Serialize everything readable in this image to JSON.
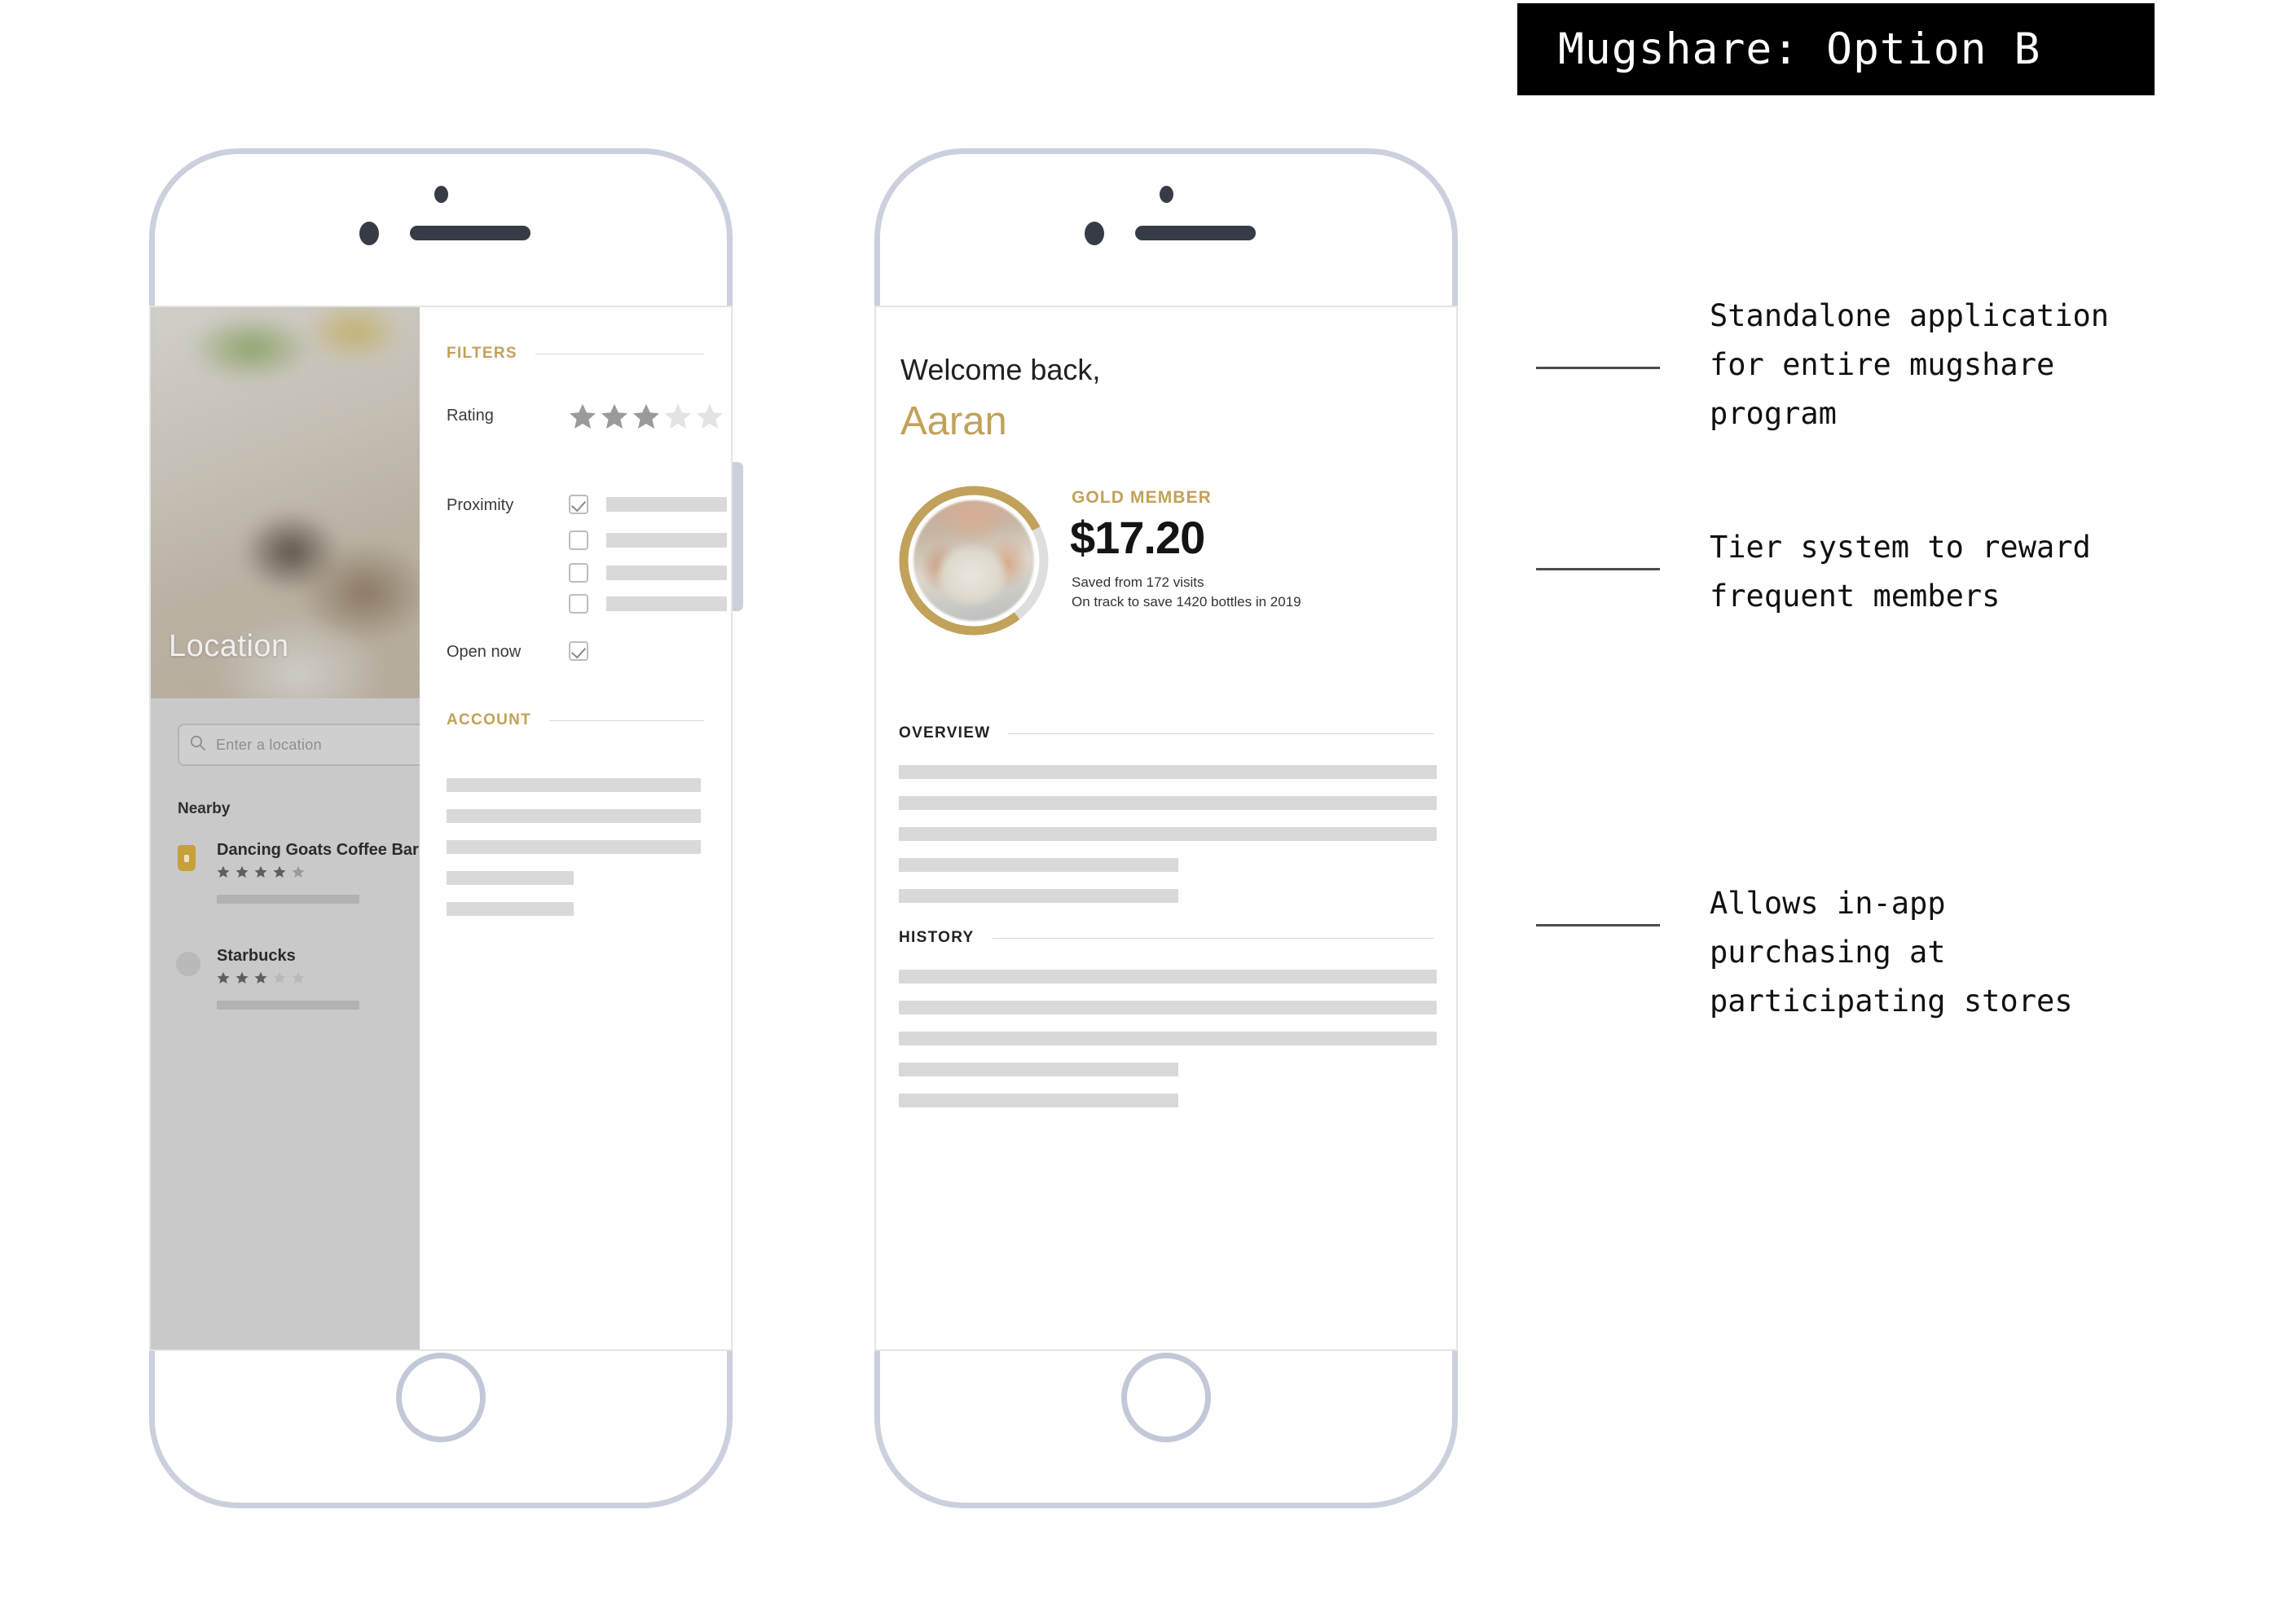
{
  "header": {
    "title": "Mugshare: Option B"
  },
  "colors": {
    "gold": "#c2a15a",
    "frame": "#ccd0dd",
    "placeholder_gray": "#d9d9d9",
    "panel_gray": "#c9c9c9",
    "ink": "#111111"
  },
  "phone_a": {
    "name": "location-screen",
    "hero": {
      "title": "Location",
      "image_alt": "blurred coffee and pastry photo"
    },
    "search": {
      "placeholder": "Enter a location",
      "value": "",
      "icon": "search-icon"
    },
    "nearby": {
      "heading": "Nearby",
      "items": [
        {
          "name": "Dancing Goats Coffee Bar",
          "icon": "coffee-cup-icon",
          "rating": 4.5,
          "stars_total": 5
        },
        {
          "name": "Starbucks",
          "icon": "circle-avatar-icon",
          "rating": 3,
          "stars_total": 5
        }
      ]
    },
    "filters": {
      "heading": "FILTERS",
      "rating": {
        "label": "Rating",
        "value": 3,
        "max": 5
      },
      "proximity": {
        "label": "Proximity",
        "options": [
          {
            "checked": true
          },
          {
            "checked": false
          },
          {
            "checked": false
          },
          {
            "checked": false
          }
        ]
      },
      "open_now": {
        "label": "Open now",
        "checked": true
      }
    },
    "account": {
      "heading": "ACCOUNT",
      "rows": [
        {
          "width_pct": 100
        },
        {
          "width_pct": 100
        },
        {
          "width_pct": 100
        },
        {
          "width_pct": 50
        },
        {
          "width_pct": 50
        }
      ]
    }
  },
  "phone_b": {
    "name": "profile-screen",
    "greeting": "Welcome back,",
    "user_name": "Aaran",
    "avatar": {
      "alt": "member holding a coffee mug",
      "progress_pct": 78
    },
    "membership": {
      "tier_label": "GOLD MEMBER",
      "amount_saved": "$17.20",
      "detail_1": "Saved from 172 visits",
      "detail_2": "On track to save 1420 bottles in 2019"
    },
    "overview": {
      "heading": "OVERVIEW",
      "rows": [
        {
          "width_pct": 100
        },
        {
          "width_pct": 100
        },
        {
          "width_pct": 100
        },
        {
          "width_pct": 52
        },
        {
          "width_pct": 52
        }
      ]
    },
    "history": {
      "heading": "HISTORY",
      "rows": [
        {
          "width_pct": 100
        },
        {
          "width_pct": 100
        },
        {
          "width_pct": 100
        },
        {
          "width_pct": 52
        },
        {
          "width_pct": 52
        }
      ]
    }
  },
  "annotations": [
    {
      "text": "Standalone application\nfor entire mugshare\nprogram"
    },
    {
      "text": "Tier system to reward\nfrequent members"
    },
    {
      "text": "Allows in-app\npurchasing at\nparticipating stores"
    }
  ]
}
